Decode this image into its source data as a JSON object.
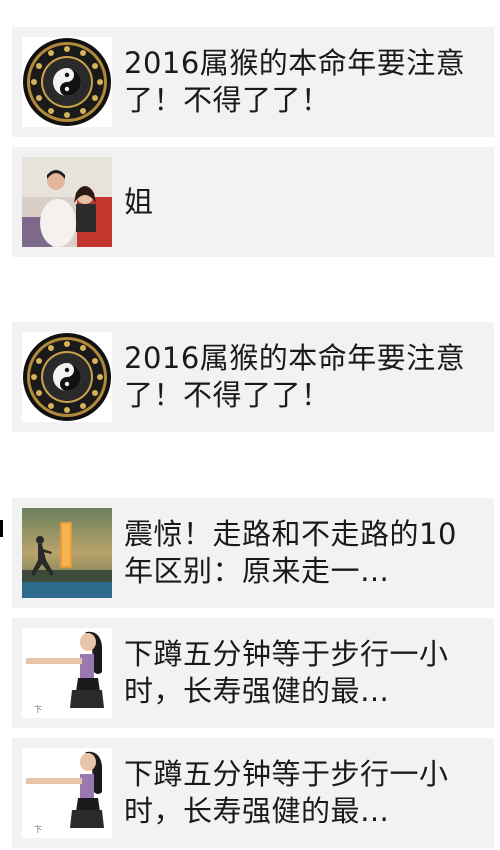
{
  "feed": {
    "items": [
      {
        "title": "2016属猴的本命年要注意了！不得了了！",
        "thumb_icon": "zodiac-wheel-icon"
      },
      {
        "title": "姐",
        "thumb_icon": "photo-two-women-icon"
      },
      {
        "title": "2016属猴的本命年要注意了！不得了了！",
        "thumb_icon": "zodiac-wheel-icon"
      },
      {
        "title": "震惊！走路和不走路的10年区别：原来走一…",
        "thumb_icon": "runner-sunset-icon"
      },
      {
        "title": "下蹲五分钟等于步行一小时，长寿强健的最…",
        "thumb_icon": "squat-woman-icon"
      },
      {
        "title": "下蹲五分钟等于步行一小时，长寿强健的最…",
        "thumb_icon": "squat-woman-icon"
      }
    ]
  },
  "colors": {
    "card_bg": "#f2f2f2",
    "text": "#1a1a1a",
    "page_bg": "#ffffff"
  }
}
